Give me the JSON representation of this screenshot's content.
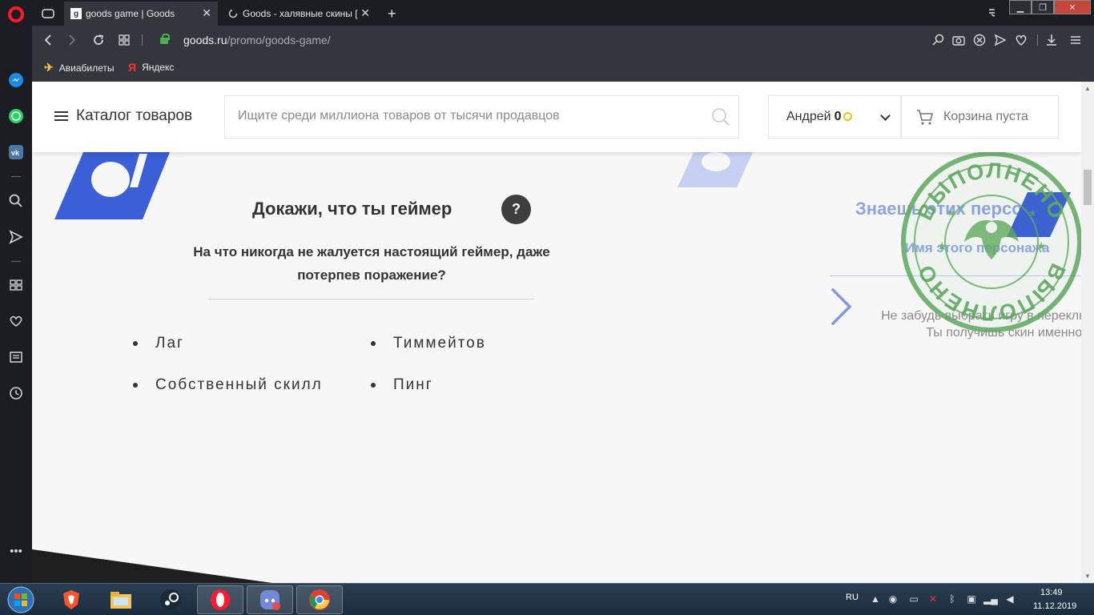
{
  "browser": {
    "tabs": [
      {
        "title": "goods game | Goods",
        "active": true,
        "favicon": "goods-g-icon"
      },
      {
        "title": "Goods - халявные скины [",
        "active": false,
        "favicon": "loading-spinner-icon"
      }
    ],
    "url_host": "goods.ru",
    "url_path": "/promo/goods-game/",
    "bookmarks": [
      {
        "label": "Авиабилеты",
        "icon": "plane-icon"
      },
      {
        "label": "Яндекс",
        "icon": "yandex-icon"
      }
    ]
  },
  "site": {
    "catalog_label": "Каталог товаров",
    "search_placeholder": "Ищите среди миллиона товаров от тысячи продавцов",
    "user_name": "Андрей",
    "user_balance": "0",
    "cart_label": "Корзина пуста"
  },
  "quiz": {
    "title": "Докажи, что ты геймер",
    "help": "?",
    "question_line1": "На что никогда не жалуется настоящий геймер, даже",
    "question_line2": "потерпев поражение?",
    "answers": [
      "Лаг",
      "Тиммейтов",
      "Собственный скилл",
      "Пинг"
    ]
  },
  "next_step": {
    "title": "Знаешь этих персонаж",
    "subtitle": "Имя этого персонажа",
    "hint_line1": "Не забудь выбрать игру в переключа",
    "hint_line2": "Ты получишь скин именно из",
    "stamp_text": "ВЫПОЛНЕНО"
  },
  "taskbar": {
    "lang": "RU",
    "time": "13:49",
    "date": "11.12.2019"
  },
  "colors": {
    "accent_blue": "#3b5fd6",
    "light_blue": "#8ea3e6",
    "stamp_green": "#4f9a4f",
    "opera_red": "#ff1b2d"
  }
}
